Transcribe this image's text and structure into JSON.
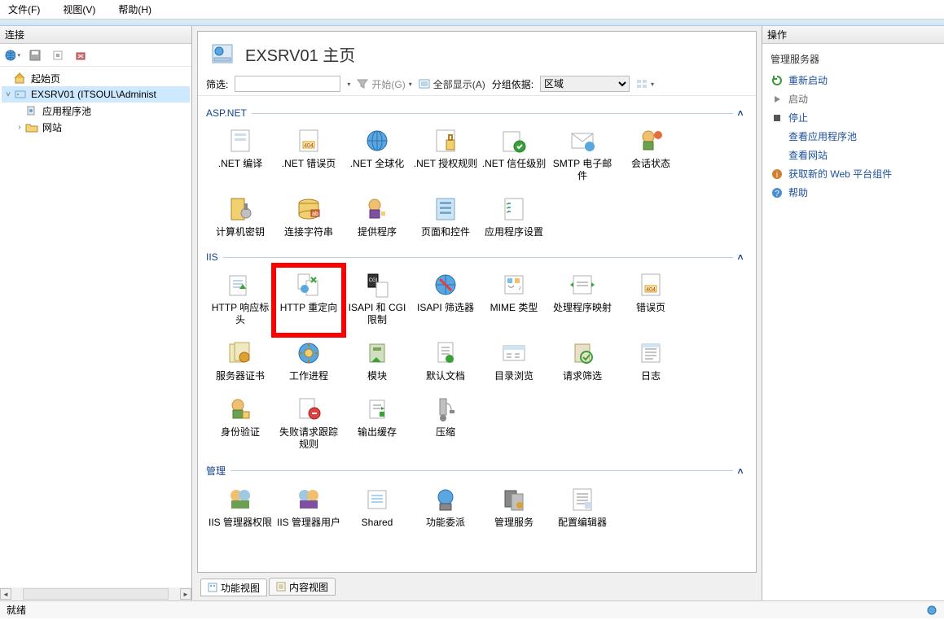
{
  "menubar": {
    "file": "文件(F)",
    "view": "视图(V)",
    "help": "帮助(H)"
  },
  "left": {
    "header": "连接",
    "tree": {
      "start": "起始页",
      "server": "EXSRV01 (ITSOUL\\Administ",
      "apppools": "应用程序池",
      "sites": "网站"
    }
  },
  "page": {
    "title": "EXSRV01 主页",
    "filter_label": "筛选:",
    "filter_value": "",
    "go_label": "开始(G)",
    "showall": "全部显示(A)",
    "groupby_label": "分组依据:",
    "groupby_value": "区域"
  },
  "groups": {
    "aspnet": {
      "title": "ASP.NET",
      "items": [
        ".NET 编译",
        ".NET 错误页",
        ".NET 全球化",
        ".NET 授权规则",
        ".NET 信任级别",
        "SMTP 电子邮件",
        "会话状态",
        "计算机密钥",
        "连接字符串",
        "提供程序",
        "页面和控件",
        "应用程序设置"
      ]
    },
    "iis": {
      "title": "IIS",
      "items": [
        "HTTP 响应标头",
        "HTTP 重定向",
        "ISAPI 和 CGI 限制",
        "ISAPI 筛选器",
        "MIME 类型",
        "处理程序映射",
        "错误页",
        "服务器证书",
        "工作进程",
        "模块",
        "默认文档",
        "目录浏览",
        "请求筛选",
        "日志",
        "身份验证",
        "失败请求跟踪规则",
        "输出缓存",
        "压缩"
      ]
    },
    "mgmt": {
      "title": "管理",
      "items": [
        "IIS 管理器权限",
        "IIS 管理器用户",
        "Shared",
        "功能委派",
        "管理服务",
        "配置编辑器"
      ]
    }
  },
  "tabs": {
    "features": "功能视图",
    "content": "内容视图"
  },
  "right": {
    "header": "操作",
    "section": "管理服务器",
    "restart": "重新启动",
    "start": "启动",
    "stop": "停止",
    "view_apppools": "查看应用程序池",
    "view_sites": "查看网站",
    "webpi": "获取新的 Web 平台组件",
    "help": "帮助"
  },
  "status": "就绪"
}
